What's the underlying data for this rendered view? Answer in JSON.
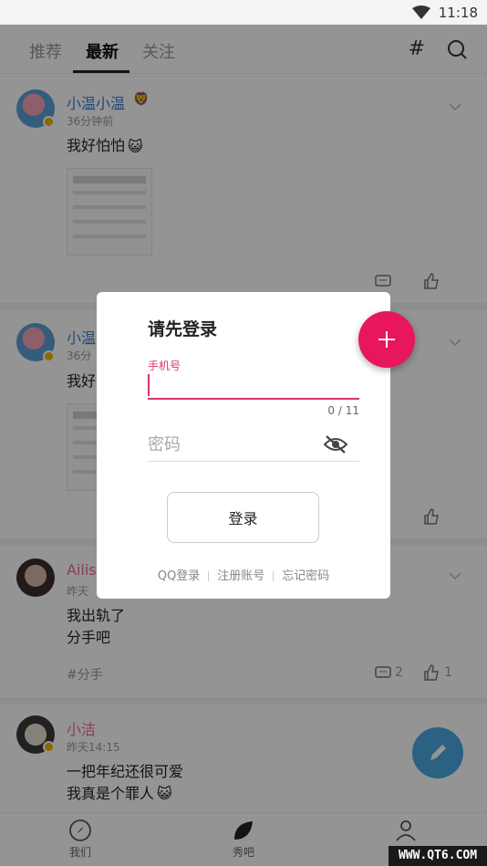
{
  "status_bar": {
    "time": "11:18"
  },
  "top_tabs": [
    {
      "label": "推荐",
      "active": false
    },
    {
      "label": "最新",
      "active": true
    },
    {
      "label": "关注",
      "active": false
    }
  ],
  "top_actions": {
    "hash_label": "#"
  },
  "posts": [
    {
      "username": "小温小温",
      "time": "36分钟前",
      "text": "我好怕怕"
    },
    {
      "username": "小温",
      "time": "36分",
      "text": "我好"
    },
    {
      "username": "Ailis",
      "time": "昨天",
      "text_lines": [
        "我出轨了",
        "分手吧"
      ],
      "tag": "#分手",
      "comments": "2",
      "likes": "1"
    },
    {
      "username": "小洁",
      "time": "昨天14:15",
      "text_lines": [
        "一把年纪还很可爱",
        "我真是个罪人"
      ]
    }
  ],
  "bottom_nav": [
    {
      "label": "我们",
      "icon": "compass-icon"
    },
    {
      "label": "秀吧",
      "icon": "leaf-icon"
    },
    {
      "label": "我的",
      "icon": "person-icon"
    }
  ],
  "watermark": "WWW.QT6.COM",
  "login_dialog": {
    "title": "请先登录",
    "phone_label": "手机号",
    "phone_value": "",
    "counter": "0 / 11",
    "password_placeholder": "密码",
    "login_button": "登录",
    "links": [
      "QQ登录",
      "注册账号",
      "忘记密码"
    ]
  },
  "colors": {
    "accent": "#e8175d",
    "input_focus": "#d8336e",
    "username_blue": "#3a7bd5",
    "fab_pen": "#4aa7e0"
  }
}
